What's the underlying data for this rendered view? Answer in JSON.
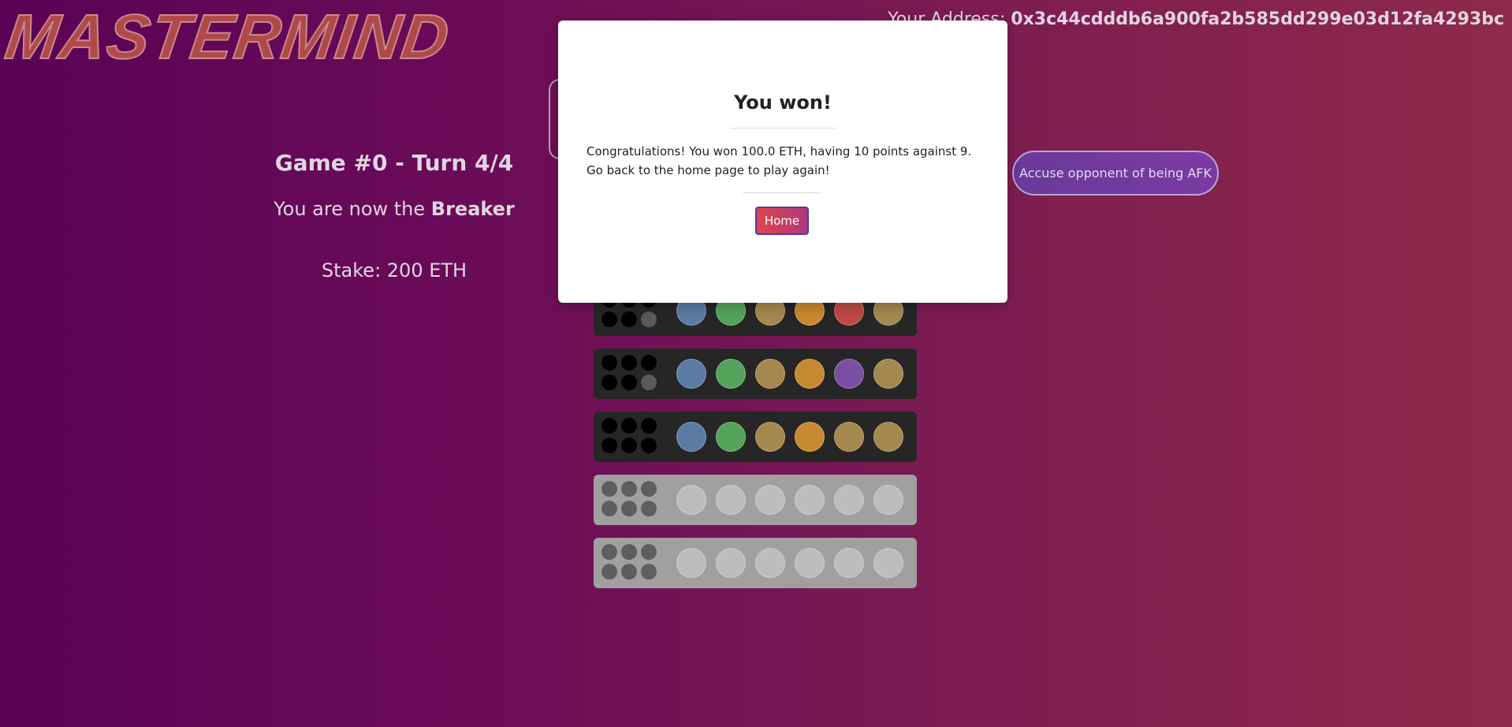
{
  "header": {
    "logo": "MASTERMIND",
    "address_label": "Your Address:",
    "address_value": "0x3c44cdddb6a900fa2b585dd299e03d12fa4293bc"
  },
  "game": {
    "title": "Game #0 - Turn 4/4",
    "role_prefix": "You are now the",
    "role_value": "Breaker",
    "stake": "Stake: 200 ETH"
  },
  "actions": {
    "afk_label": "Accuse opponent of being AFK"
  },
  "modal": {
    "title": "You won!",
    "message": "Congratulations! You won 100.0 ETH, having 10 points against 9. Go back to the home page to play again!",
    "home_label": "Home"
  },
  "colors": {
    "blue": "#5b7ba2",
    "green": "#55a35a",
    "tan": "#a4884e",
    "orange": "#c88a30",
    "red": "#c04a44",
    "purple": "#7a4ea2",
    "empty_peg": "#bdbdbd",
    "pin_black": "#000000",
    "pin_grey": "#5a5a5a",
    "pin_empty": "#5e5e5e"
  },
  "board": {
    "rows": [
      {
        "state": "filled",
        "pegs": [
          "blue",
          "green",
          "tan",
          "orange",
          "red",
          "tan"
        ],
        "pins": [
          "black",
          "black",
          "black",
          "black",
          "black",
          "grey"
        ]
      },
      {
        "state": "filled",
        "pegs": [
          "blue",
          "green",
          "tan",
          "orange",
          "purple",
          "tan"
        ],
        "pins": [
          "black",
          "black",
          "black",
          "black",
          "black",
          "grey"
        ]
      },
      {
        "state": "filled",
        "pegs": [
          "blue",
          "green",
          "tan",
          "orange",
          "tan",
          "tan"
        ],
        "pins": [
          "black",
          "black",
          "black",
          "black",
          "black",
          "black"
        ]
      },
      {
        "state": "empty",
        "pegs": [
          "empty",
          "empty",
          "empty",
          "empty",
          "empty",
          "empty"
        ],
        "pins": [
          "empty",
          "empty",
          "empty",
          "empty",
          "empty",
          "empty"
        ]
      },
      {
        "state": "empty",
        "pegs": [
          "empty",
          "empty",
          "empty",
          "empty",
          "empty",
          "empty"
        ],
        "pins": [
          "empty",
          "empty",
          "empty",
          "empty",
          "empty",
          "empty"
        ]
      }
    ]
  }
}
